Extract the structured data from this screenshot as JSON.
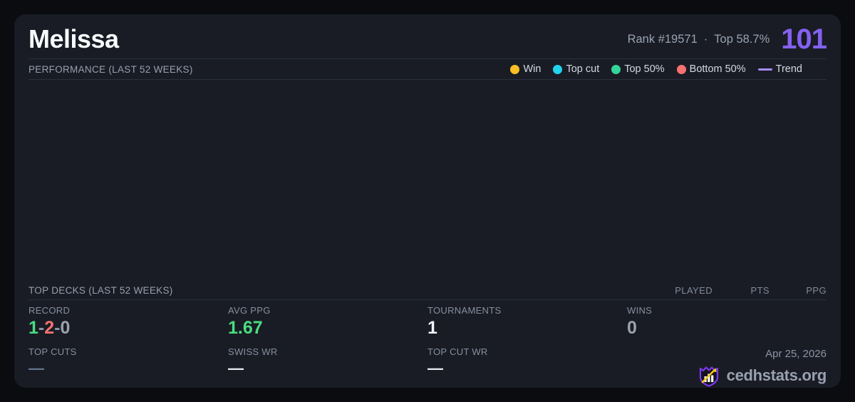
{
  "colors": {
    "accent_purple": "#8561f0",
    "positive_green": "#4ade80",
    "negative_red": "#f87171",
    "neutral_gray": "#9ca3af"
  },
  "header": {
    "player_name": "Melissa",
    "rank": "Rank #19571",
    "separator": "·",
    "top_percent": "Top 58.7%",
    "points": "101"
  },
  "performance": {
    "title": "PERFORMANCE (LAST 52 WEEKS)",
    "legend": [
      {
        "label": "Win",
        "color": "#fbbf24"
      },
      {
        "label": "Top cut",
        "color": "#22d3ee"
      },
      {
        "label": "Top 50%",
        "color": "#34d399"
      },
      {
        "label": "Bottom 50%",
        "color": "#f87171"
      },
      {
        "label": "Trend",
        "color": "#a78bfa"
      }
    ]
  },
  "top_decks": {
    "title": "TOP DECKS (LAST 52 WEEKS)",
    "columns": [
      "PLAYED",
      "PTS",
      "PPG"
    ],
    "rows": []
  },
  "stats": {
    "record": {
      "label": "RECORD",
      "wins": "1",
      "losses": "2",
      "draws": "0",
      "separator": "-"
    },
    "avg_ppg": {
      "label": "AVG PPG",
      "value": "1.67"
    },
    "tournaments": {
      "label": "TOURNAMENTS",
      "value": "1"
    },
    "wins": {
      "label": "WINS",
      "value": "0"
    },
    "top_cuts": {
      "label": "TOP CUTS",
      "value": "—"
    },
    "swiss_wr": {
      "label": "SWISS WR",
      "value": "—"
    },
    "top_cut_wr": {
      "label": "TOP CUT WR",
      "value": "—"
    }
  },
  "footer": {
    "date": "Apr 25, 2026",
    "site": "cedhstats.org"
  }
}
